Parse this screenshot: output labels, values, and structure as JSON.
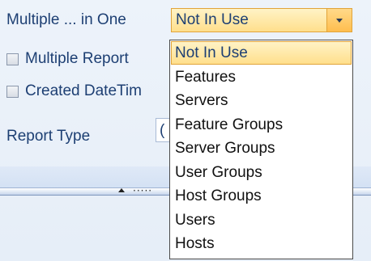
{
  "form": {
    "multiple_label": "Multiple ... in One",
    "multiple_report_label": "Multiple Report",
    "created_datetime_label": "Created DateTim",
    "report_type_label": "Report Type",
    "report_type_value_partial": "("
  },
  "combo": {
    "selected_value": "Not In Use"
  },
  "dropdown": {
    "items": [
      "Not In Use",
      "Features",
      "Servers",
      "Feature Groups",
      "Server Groups",
      "User Groups",
      "Host Groups",
      "Users",
      "Hosts"
    ],
    "selected_index": 0
  },
  "splitter": {
    "grip_dots": "·····"
  }
}
